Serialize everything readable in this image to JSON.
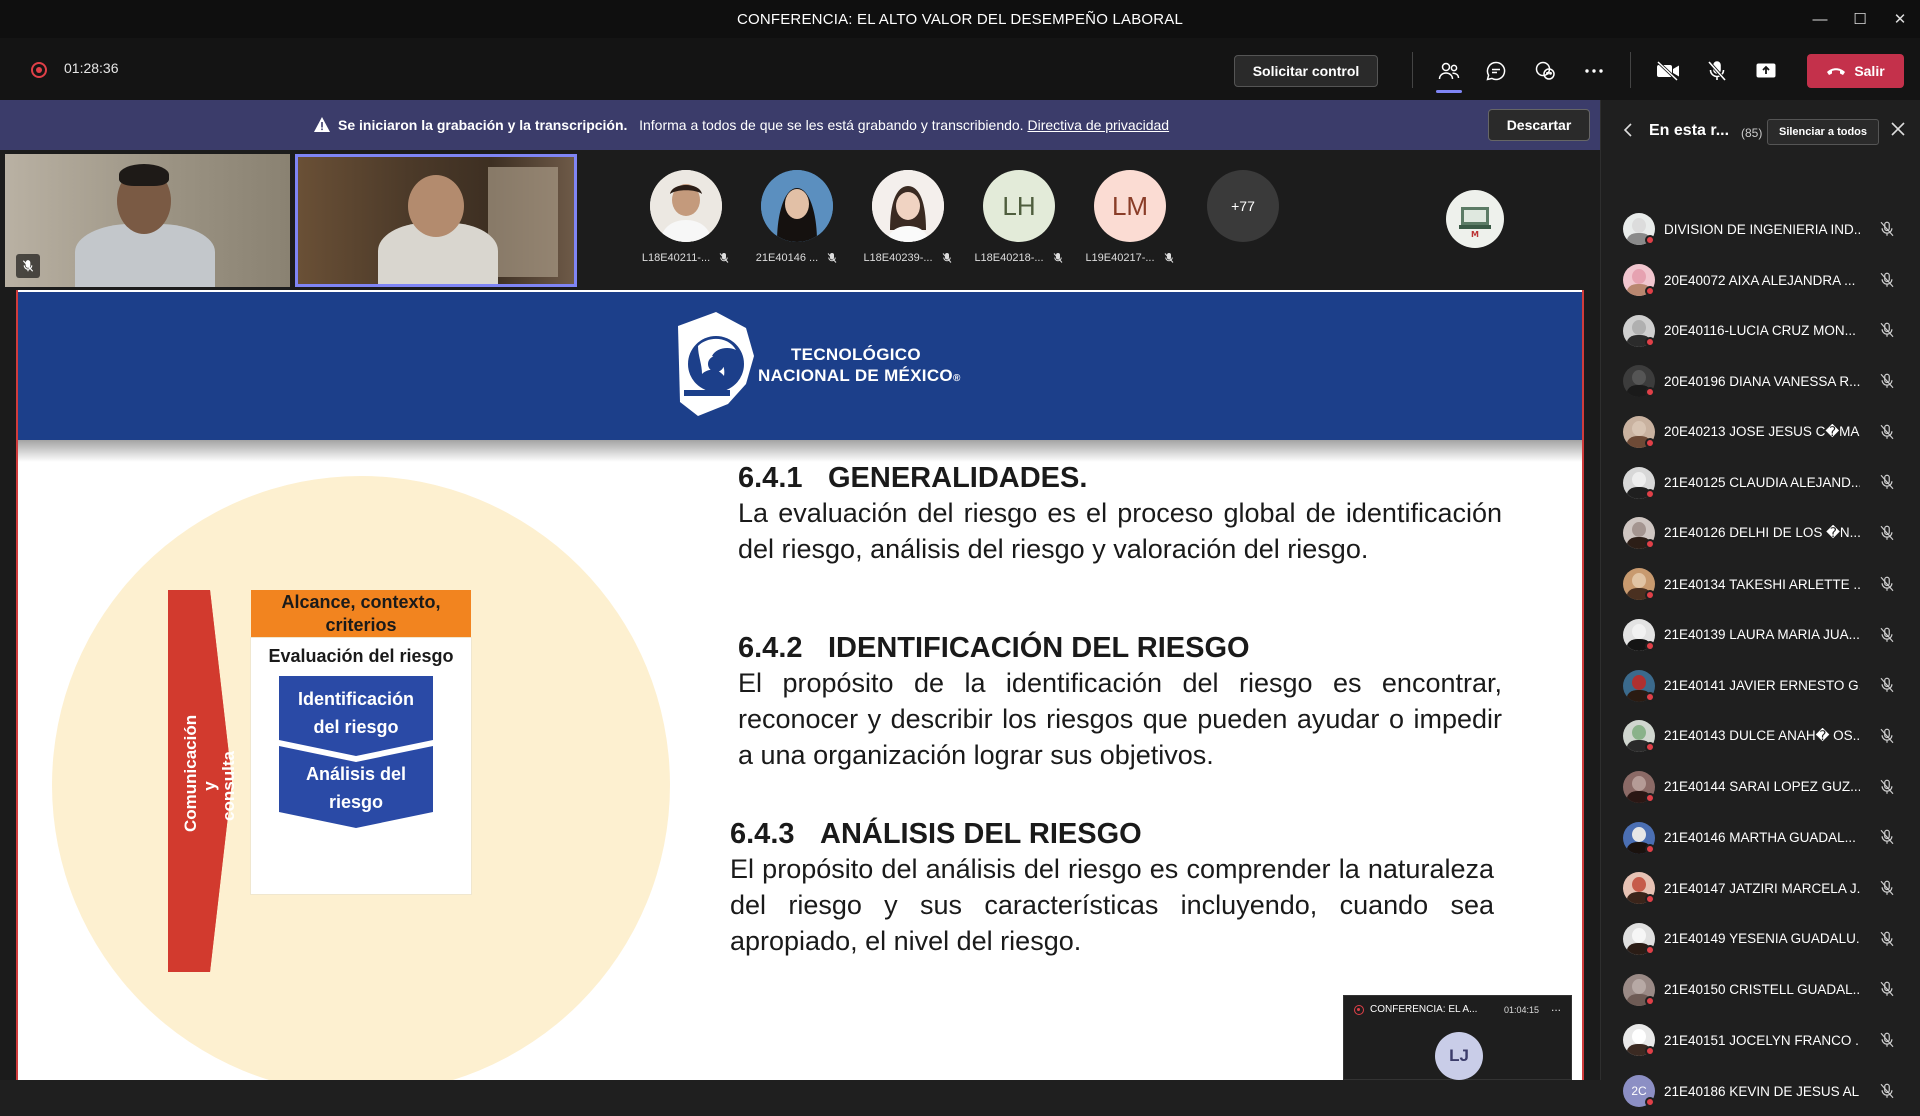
{
  "window": {
    "title": "CONFERENCIA: EL ALTO VALOR DEL DESEMPEÑO LABORAL",
    "minimize_glyph": "—",
    "maximize_glyph": "☐",
    "close_glyph": "✕"
  },
  "toolbar": {
    "timer": "01:28:36",
    "request_control_label": "Solicitar control",
    "leave_label": "Salir",
    "icons": [
      "people-icon",
      "chat-icon",
      "reactions-icon",
      "more-icon",
      "camera-off-icon",
      "mic-off-icon",
      "share-icon",
      "phone-icon"
    ],
    "accent_color": "#7f85f5",
    "leave_color": "#c4314b"
  },
  "banner": {
    "bold_text": "Se iniciaron la grabación y la transcripción.",
    "text": "Informa a todos de que se les está grabando y transcribiendo.",
    "link_text": "Directiva de privacidad",
    "dismiss_label": "Descartar",
    "color": "#3b3c6a"
  },
  "gallery": {
    "participants": [
      {
        "name": "L18E40211-...",
        "type": "photo"
      },
      {
        "name": "21E40146 ...",
        "type": "photo"
      },
      {
        "name": "L18E40239-...",
        "type": "photo"
      },
      {
        "name": "L18E40218-...",
        "initials": "LH"
      },
      {
        "name": "L19E40217-...",
        "initials": "LM"
      }
    ],
    "more_count": "+77"
  },
  "slide": {
    "logo_line1": "TECNOLÓGICO",
    "logo_line2": "NACIONAL DE MÉXICO",
    "logo_reg": "®",
    "diagram": {
      "side_label_line1": "Comunicación y",
      "side_label_line2": "consulta",
      "top_box_line1": "Alcance, contexto,",
      "top_box_line2": "criterios",
      "eval_title": "Evaluación del riesgo",
      "chevron1_line1": "Identificación",
      "chevron1_line2": "del riesgo",
      "chevron2_line1": "Análisis del",
      "chevron2_line2": "riesgo"
    },
    "sections": [
      {
        "number": "6.4.1",
        "title": "GENERALIDADES.",
        "body": "La evaluación del riesgo es el proceso global de identificación del riesgo, análisis del riesgo y valoración del riesgo."
      },
      {
        "number": "6.4.2",
        "title": "IDENTIFICACIÓN DEL RIESGO",
        "body": "El propósito de la identificación del riesgo es encontrar, reconocer y describir los riesgos que pueden ayudar o impedir a una organización lograr sus objetivos."
      },
      {
        "number": "6.4.3",
        "title": "ANÁLISIS DEL RIESGO",
        "body": "El propósito del análisis del riesgo es comprender la naturaleza del riesgo y sus características incluyendo, cuando sea apropiado, el nivel del riesgo."
      }
    ]
  },
  "mini_window": {
    "title": "CONFERENCIA: EL A...",
    "timer": "01:04:15",
    "more": "...",
    "avatar_initials": "LJ"
  },
  "panel": {
    "title": "En esta r...",
    "count": "(85)",
    "mute_all_label": "Silenciar a todos",
    "participants": [
      "DIVISION DE INGENIERIA IND...",
      "20E40072 AIXA ALEJANDRA ...",
      "20E40116-LUCIA CRUZ MON...",
      "20E40196 DIANA VANESSA R...",
      "20E40213 JOSE JESUS C�MA...",
      "21E40125 CLAUDIA ALEJAND...",
      "21E40126 DELHI DE LOS �N...",
      "21E40134 TAKESHI ARLETTE ...",
      "21E40139 LAURA MARIA JUA...",
      "21E40141 JAVIER ERNESTO G...",
      "21E40143 DULCE ANAH� OS...",
      "21E40144 SARAI LOPEZ GUZ...",
      "21E40146 MARTHA GUADAL...",
      "21E40147 JATZIRI MARCELA J...",
      "21E40149 YESENIA GUADALU...",
      "21E40150 CRISTELL GUADAL...",
      "21E40151 JOCELYN FRANCO ...",
      "21E40186 KEVIN DE JESUS AL..."
    ],
    "last_avatar_initials": "2C"
  }
}
